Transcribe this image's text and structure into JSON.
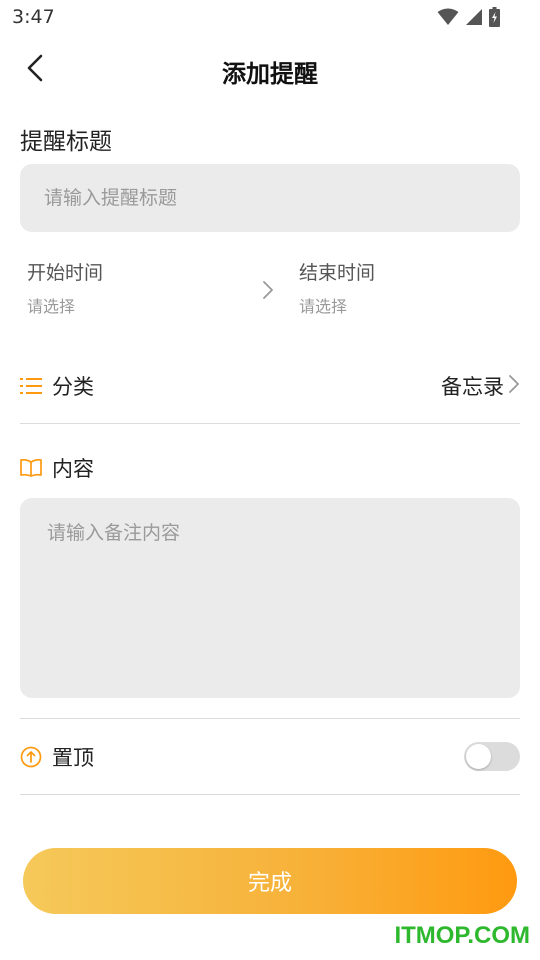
{
  "status_bar": {
    "time": "3:47",
    "icons": [
      "wifi-icon",
      "signal-icon",
      "battery-charging-icon"
    ]
  },
  "header": {
    "title": "添加提醒",
    "back_icon": "chevron-left-icon"
  },
  "title_section": {
    "label": "提醒标题",
    "placeholder": "请输入提醒标题",
    "value": ""
  },
  "time_section": {
    "start_label": "开始时间",
    "start_value": "请选择",
    "end_label": "结束时间",
    "end_value": "请选择"
  },
  "category": {
    "label": "分类",
    "value": "备忘录",
    "icon": "list-icon"
  },
  "content_section": {
    "label": "内容",
    "placeholder": "请输入备注内容",
    "value": "",
    "icon": "book-icon"
  },
  "pin": {
    "label": "置顶",
    "icon": "arrow-up-circle-icon",
    "enabled": false
  },
  "done_button": {
    "label": "完成"
  },
  "watermark": "ITMOP.COM",
  "colors": {
    "accent": "#ff9a10",
    "accent_light": "#f5c95a",
    "input_bg": "#ebebeb",
    "watermark": "#2eb82e"
  }
}
